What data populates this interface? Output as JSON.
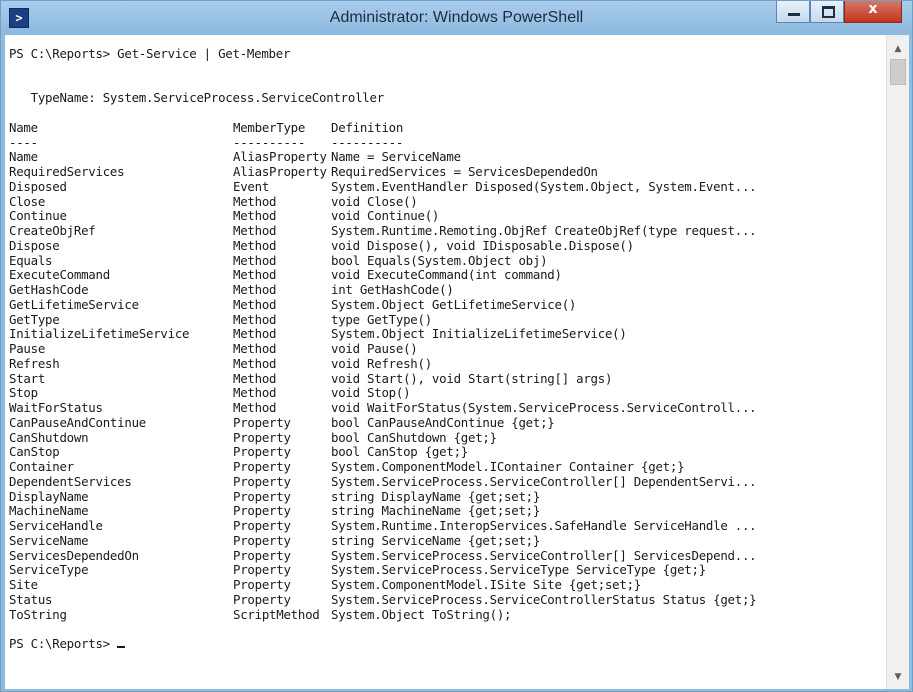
{
  "window": {
    "title": "Administrator: Windows PowerShell",
    "icon": "powershell-icon",
    "close_glyph": "x"
  },
  "console": {
    "prompt_command": "PS C:\\Reports> Get-Service | Get-Member",
    "typename": "   TypeName: System.ServiceProcess.ServiceController",
    "headers": [
      "Name",
      "MemberType",
      "Definition"
    ],
    "underlines": [
      "----",
      "----------",
      "----------"
    ],
    "members": [
      [
        "Name",
        "AliasProperty",
        "Name = ServiceName"
      ],
      [
        "RequiredServices",
        "AliasProperty",
        "RequiredServices = ServicesDependedOn"
      ],
      [
        "Disposed",
        "Event",
        "System.EventHandler Disposed(System.Object, System.Event..."
      ],
      [
        "Close",
        "Method",
        "void Close()"
      ],
      [
        "Continue",
        "Method",
        "void Continue()"
      ],
      [
        "CreateObjRef",
        "Method",
        "System.Runtime.Remoting.ObjRef CreateObjRef(type request..."
      ],
      [
        "Dispose",
        "Method",
        "void Dispose(), void IDisposable.Dispose()"
      ],
      [
        "Equals",
        "Method",
        "bool Equals(System.Object obj)"
      ],
      [
        "ExecuteCommand",
        "Method",
        "void ExecuteCommand(int command)"
      ],
      [
        "GetHashCode",
        "Method",
        "int GetHashCode()"
      ],
      [
        "GetLifetimeService",
        "Method",
        "System.Object GetLifetimeService()"
      ],
      [
        "GetType",
        "Method",
        "type GetType()"
      ],
      [
        "InitializeLifetimeService",
        "Method",
        "System.Object InitializeLifetimeService()"
      ],
      [
        "Pause",
        "Method",
        "void Pause()"
      ],
      [
        "Refresh",
        "Method",
        "void Refresh()"
      ],
      [
        "Start",
        "Method",
        "void Start(), void Start(string[] args)"
      ],
      [
        "Stop",
        "Method",
        "void Stop()"
      ],
      [
        "WaitForStatus",
        "Method",
        "void WaitForStatus(System.ServiceProcess.ServiceControll..."
      ],
      [
        "CanPauseAndContinue",
        "Property",
        "bool CanPauseAndContinue {get;}"
      ],
      [
        "CanShutdown",
        "Property",
        "bool CanShutdown {get;}"
      ],
      [
        "CanStop",
        "Property",
        "bool CanStop {get;}"
      ],
      [
        "Container",
        "Property",
        "System.ComponentModel.IContainer Container {get;}"
      ],
      [
        "DependentServices",
        "Property",
        "System.ServiceProcess.ServiceController[] DependentServi..."
      ],
      [
        "DisplayName",
        "Property",
        "string DisplayName {get;set;}"
      ],
      [
        "MachineName",
        "Property",
        "string MachineName {get;set;}"
      ],
      [
        "ServiceHandle",
        "Property",
        "System.Runtime.InteropServices.SafeHandle ServiceHandle ..."
      ],
      [
        "ServiceName",
        "Property",
        "string ServiceName {get;set;}"
      ],
      [
        "ServicesDependedOn",
        "Property",
        "System.ServiceProcess.ServiceController[] ServicesDepend..."
      ],
      [
        "ServiceType",
        "Property",
        "System.ServiceProcess.ServiceType ServiceType {get;}"
      ],
      [
        "Site",
        "Property",
        "System.ComponentModel.ISite Site {get;set;}"
      ],
      [
        "Status",
        "Property",
        "System.ServiceProcess.ServiceControllerStatus Status {get;}"
      ],
      [
        "ToString",
        "ScriptMethod",
        "System.Object ToString();"
      ]
    ],
    "final_prompt": "PS C:\\Reports> "
  }
}
